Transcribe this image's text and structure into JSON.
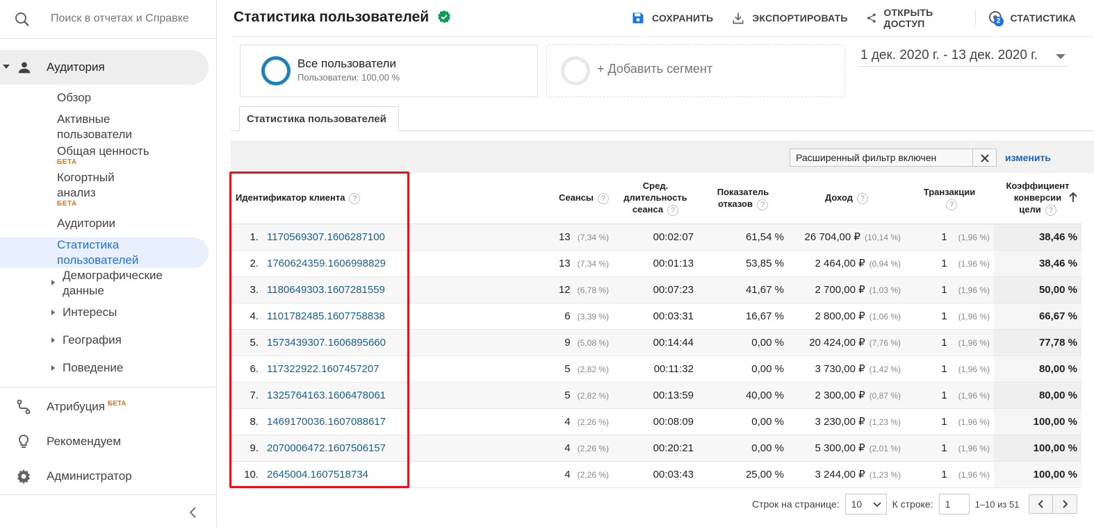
{
  "sidebar": {
    "search_placeholder": "Поиск в отчетах и Справке",
    "audience_label": "Аудитория",
    "items": [
      {
        "label": "Обзор"
      },
      {
        "label": "Активные пользователи"
      },
      {
        "label": "Общая ценность",
        "badge": "БЕТА"
      },
      {
        "label": "Когортный анализ",
        "badge": "БЕТА"
      },
      {
        "label": "Аудитории"
      },
      {
        "label": "Статистика пользователей"
      }
    ],
    "expandable": [
      {
        "label": "Демографические данные"
      },
      {
        "label": "Интересы"
      },
      {
        "label": "География"
      },
      {
        "label": "Поведение"
      }
    ],
    "bottom": [
      {
        "label": "Атрибуция",
        "badge": "БЕТА"
      },
      {
        "label": "Рекомендуем"
      },
      {
        "label": "Администратор"
      }
    ]
  },
  "header": {
    "title": "Статистика пользователей",
    "actions": {
      "save": "СОХРАНИТЬ",
      "export": "ЭКСПОРТИРОВАТЬ",
      "share": "ОТКРЫТЬ ДОСТУП",
      "stats": "СТАТИСТИКА",
      "stats_badge": "2"
    }
  },
  "segments": {
    "all_users": "Все пользователи",
    "all_users_pct": "Пользователи: 100,00 %",
    "add_segment": "+ Добавить сегмент"
  },
  "date_range": "1 дек. 2020 г. - 13 дек. 2020 г.",
  "tab": "Статистика пользователей",
  "filter": {
    "text": "Расширенный фильтр включен",
    "change": "изменить"
  },
  "table": {
    "headers": {
      "client_id": "Идентификатор клиента",
      "sessions": "Сеансы",
      "duration_l1": "Сред.",
      "duration_l2": "длительность",
      "duration_l3": "сеанса",
      "bounce_l1": "Показатель",
      "bounce_l2": "отказов",
      "revenue": "Доход",
      "transactions": "Транзакции",
      "conv_l1": "Коэффициент",
      "conv_l2": "конверсии",
      "conv_l3": "цели"
    },
    "rows": [
      {
        "n": "1.",
        "id": "1170569307.1606287100",
        "sessions": "13",
        "sessions_pct": "(7,34 %)",
        "duration": "00:02:07",
        "bounce": "61,54 %",
        "revenue": "26 704,00 ₽",
        "revenue_pct": "(10,14 %)",
        "tx": "1",
        "tx_pct": "(1,96 %)",
        "conv": "38,46 %"
      },
      {
        "n": "2.",
        "id": "1760624359.1606998829",
        "sessions": "13",
        "sessions_pct": "(7,34 %)",
        "duration": "00:01:13",
        "bounce": "53,85 %",
        "revenue": "2 464,00 ₽",
        "revenue_pct": "(0,94 %)",
        "tx": "1",
        "tx_pct": "(1,96 %)",
        "conv": "38,46 %"
      },
      {
        "n": "3.",
        "id": "1180649303.1607281559",
        "sessions": "12",
        "sessions_pct": "(6,78 %)",
        "duration": "00:07:23",
        "bounce": "41,67 %",
        "revenue": "2 700,00 ₽",
        "revenue_pct": "(1,03 %)",
        "tx": "1",
        "tx_pct": "(1,96 %)",
        "conv": "50,00 %"
      },
      {
        "n": "4.",
        "id": "1101782485.1607758838",
        "sessions": "6",
        "sessions_pct": "(3,39 %)",
        "duration": "00:03:31",
        "bounce": "16,67 %",
        "revenue": "2 800,00 ₽",
        "revenue_pct": "(1,06 %)",
        "tx": "1",
        "tx_pct": "(1,96 %)",
        "conv": "66,67 %"
      },
      {
        "n": "5.",
        "id": "1573439307.1606895660",
        "sessions": "9",
        "sessions_pct": "(5,08 %)",
        "duration": "00:14:44",
        "bounce": "0,00 %",
        "revenue": "20 424,00 ₽",
        "revenue_pct": "(7,76 %)",
        "tx": "1",
        "tx_pct": "(1,96 %)",
        "conv": "77,78 %"
      },
      {
        "n": "6.",
        "id": "117322922.1607457207",
        "sessions": "5",
        "sessions_pct": "(2,82 %)",
        "duration": "00:11:32",
        "bounce": "0,00 %",
        "revenue": "3 730,00 ₽",
        "revenue_pct": "(1,42 %)",
        "tx": "1",
        "tx_pct": "(1,96 %)",
        "conv": "80,00 %"
      },
      {
        "n": "7.",
        "id": "1325764163.1606478061",
        "sessions": "5",
        "sessions_pct": "(2,82 %)",
        "duration": "00:13:59",
        "bounce": "40,00 %",
        "revenue": "2 300,00 ₽",
        "revenue_pct": "(0,87 %)",
        "tx": "1",
        "tx_pct": "(1,96 %)",
        "conv": "80,00 %"
      },
      {
        "n": "8.",
        "id": "1469170036.1607088617",
        "sessions": "4",
        "sessions_pct": "(2,26 %)",
        "duration": "00:08:09",
        "bounce": "0,00 %",
        "revenue": "3 230,00 ₽",
        "revenue_pct": "(1,23 %)",
        "tx": "1",
        "tx_pct": "(1,96 %)",
        "conv": "100,00 %"
      },
      {
        "n": "9.",
        "id": "2070006472.1607506157",
        "sessions": "4",
        "sessions_pct": "(2,26 %)",
        "duration": "00:20:21",
        "bounce": "0,00 %",
        "revenue": "5 300,00 ₽",
        "revenue_pct": "(2,01 %)",
        "tx": "1",
        "tx_pct": "(1,96 %)",
        "conv": "100,00 %"
      },
      {
        "n": "10.",
        "id": "2645004.1607518734",
        "sessions": "4",
        "sessions_pct": "(2,26 %)",
        "duration": "00:03:43",
        "bounce": "25,00 %",
        "revenue": "3 244,00 ₽",
        "revenue_pct": "(1,23 %)",
        "tx": "1",
        "tx_pct": "(1,96 %)",
        "conv": "100,00 %"
      }
    ]
  },
  "pager": {
    "rows_label": "Строк на странице:",
    "rows_value": "10",
    "goto_label": "К строке:",
    "goto_value": "1",
    "range": "1–10 из 51"
  },
  "colors": {
    "highlight_box": "#e8111a",
    "link": "#1a5f8b",
    "segment_ring": "#1c81b9"
  }
}
